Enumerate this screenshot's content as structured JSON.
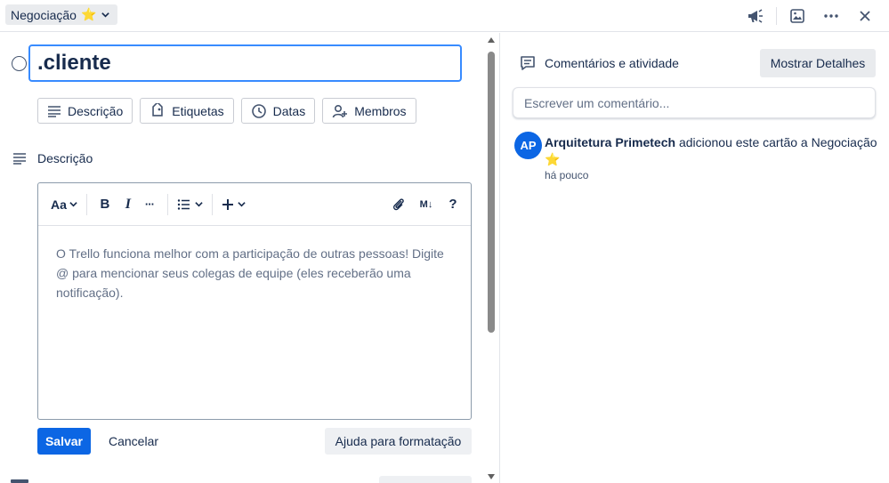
{
  "header": {
    "list_name": "Negociação",
    "star": "⭐",
    "icons": [
      "megaphone-icon",
      "image-icon",
      "more-icon",
      "close-icon"
    ]
  },
  "card": {
    "title": ".cliente"
  },
  "chips": [
    {
      "label": "Descrição",
      "icon": "description-icon"
    },
    {
      "label": "Etiquetas",
      "icon": "label-icon"
    },
    {
      "label": "Datas",
      "icon": "clock-icon"
    },
    {
      "label": "Membros",
      "icon": "add-member-icon"
    }
  ],
  "description": {
    "heading": "Descrição",
    "toolbar": {
      "text_style": "Aa",
      "bold": "B",
      "italic": "I",
      "more": "···",
      "markdown": "M↓",
      "help": "?"
    },
    "placeholder": "O Trello funciona melhor com a participação de outras pessoas! Digite @ para mencionar seus colegas de equipe (eles receberão uma notificação).",
    "save_label": "Salvar",
    "cancel_label": "Cancelar",
    "help_label": "Ajuda para formatação"
  },
  "activity": {
    "heading": "Comentários e atividade",
    "details_label": "Mostrar Detalhes",
    "comment_placeholder": "Escrever um comentário...",
    "avatar_initials": "AP",
    "user": "Arquitetura Primetech",
    "action": "adicionou este cartão a Negociação",
    "star": "⭐",
    "time": "há pouco"
  },
  "colors": {
    "primary": "#0c66e4",
    "focus": "#388bff",
    "star": "#f5cd47"
  }
}
